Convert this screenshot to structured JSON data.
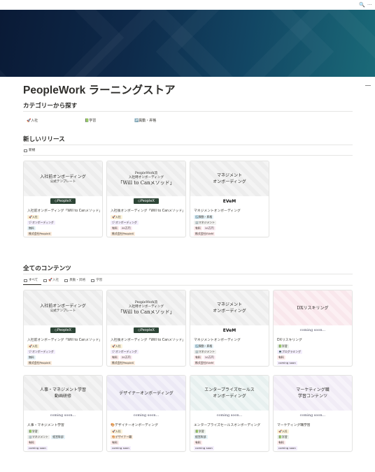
{
  "topbar": {
    "search_icon": "🔍",
    "more_icon": "···"
  },
  "page": {
    "title": "PeopleWork ラーニングストア"
  },
  "categories": {
    "heading": "カテゴリーから探す",
    "items": [
      {
        "label": "🚀入社"
      },
      {
        "label": "📗学習"
      },
      {
        "label": "↗️異動・昇格"
      }
    ]
  },
  "new_releases": {
    "heading": "新しいリリース",
    "view_label": "新規",
    "cards": [
      {
        "thumb_lines": [
          "入社前オンボーディング",
          "公式テンプレート"
        ],
        "logo": "◇PeopleX",
        "title": "入社前オンボーディング「Will to Canメソッド」",
        "rows": [
          [
            {
              "text": "🚀入社",
              "color": "yellow"
            }
          ],
          [
            {
              "text": "🏳オンボーディング",
              "color": "purple"
            }
          ],
          [
            {
              "text": "無料",
              "color": "blue"
            }
          ],
          [
            {
              "text": "株式会社PeopleX",
              "color": "orange"
            }
          ]
        ]
      },
      {
        "thumb_lines": [
          "PeopleWork流",
          "入社時オンボーディング",
          "「Will to Canメソッド」"
        ],
        "logo": "◇PeopleX",
        "title": "入社後オンボーディング「Will to Canメソッド」",
        "rows": [
          [
            {
              "text": "🚀入社",
              "color": "yellow"
            }
          ],
          [
            {
              "text": "🏳オンボーディング",
              "color": "purple"
            }
          ],
          [
            {
              "text": "有料",
              "color": "red"
            },
            {
              "text": "20万円",
              "color": "pink"
            }
          ],
          [
            {
              "text": "株式会社PeopleX",
              "color": "orange"
            }
          ]
        ]
      },
      {
        "thumb_lines": [
          "マネジメント",
          "オンボーディング"
        ],
        "logo": "EVeM",
        "title": "マネジメントオンボーディング",
        "rows": [
          [
            {
              "text": "↗️異動・昇格",
              "color": "blue"
            }
          ],
          [
            {
              "text": "🏢マネジメント",
              "color": "gray"
            }
          ],
          [
            {
              "text": "有料",
              "color": "red"
            },
            {
              "text": "10万円",
              "color": "pink"
            }
          ],
          [
            {
              "text": "株式会社EVeM",
              "color": "red"
            }
          ]
        ]
      }
    ]
  },
  "all_contents": {
    "heading": "全てのコンテンツ",
    "tabs": [
      {
        "label": "すべて"
      },
      {
        "label": "🚀入社"
      },
      {
        "label": "異動・昇格"
      },
      {
        "label": "学習"
      }
    ],
    "cards": [
      {
        "thumb_lines": [
          "入社前オンボーディング",
          "公式テンプレート"
        ],
        "logo": "◇PeopleX",
        "title": "入社前オンボーディング「Will to Canメソッド」",
        "rows": [
          [
            {
              "text": "🚀入社",
              "color": "yellow"
            }
          ],
          [
            {
              "text": "🏳オンボーディング",
              "color": "purple"
            }
          ],
          [
            {
              "text": "無料",
              "color": "blue"
            }
          ],
          [
            {
              "text": "株式会社PeopleX",
              "color": "orange"
            }
          ]
        ]
      },
      {
        "thumb_lines": [
          "PeopleWork流",
          "入社時オンボーディング",
          "「Will to Canメソッド」"
        ],
        "logo": "◇PeopleX",
        "title": "入社後オンボーディング「Will to Canメソッド」",
        "rows": [
          [
            {
              "text": "🚀入社",
              "color": "yellow"
            }
          ],
          [
            {
              "text": "🏳オンボーディング",
              "color": "purple"
            }
          ],
          [
            {
              "text": "有料",
              "color": "red"
            },
            {
              "text": "20万円",
              "color": "pink"
            }
          ],
          [
            {
              "text": "株式会社PeopleX",
              "color": "orange"
            }
          ]
        ]
      },
      {
        "thumb_lines": [
          "マネジメント",
          "オンボーディング"
        ],
        "logo": "EVeM",
        "title": "マネジメントオンボーディング",
        "rows": [
          [
            {
              "text": "↗️異動・昇格",
              "color": "blue"
            }
          ],
          [
            {
              "text": "🏢マネジメント",
              "color": "gray"
            }
          ],
          [
            {
              "text": "有料",
              "color": "red"
            },
            {
              "text": "10万円",
              "color": "pink"
            }
          ],
          [
            {
              "text": "株式会社EVeM",
              "color": "red"
            }
          ]
        ]
      },
      {
        "thumb_lines": [
          "DXリスキリング"
        ],
        "soon": "coming soon...",
        "title": "DXリスキリング",
        "rows": [
          [
            {
              "text": "📗学習",
              "color": "green"
            }
          ],
          [
            {
              "text": "💻プログラミング",
              "color": "purple"
            }
          ],
          [
            {
              "text": "有料",
              "color": "red"
            }
          ],
          [
            {
              "text": "coming soon",
              "color": "purple"
            }
          ]
        ]
      },
      {
        "thumb_lines": [
          "人事・マネジメント学習",
          "動画研修"
        ],
        "soon": "coming soon...",
        "title": "人事・マネジメント学習",
        "rows": [
          [
            {
              "text": "📗学習",
              "color": "green"
            }
          ],
          [
            {
              "text": "🏢マネジメント",
              "color": "gray"
            },
            {
              "text": "経営幹部",
              "color": "blue"
            }
          ],
          [
            {
              "text": "有料",
              "color": "red"
            }
          ],
          [
            {
              "text": "coming soon",
              "color": "purple"
            }
          ]
        ]
      },
      {
        "thumb_lines": [
          "デザイナーオンボーディング"
        ],
        "soon": "coming soon...",
        "title": "🎨デザイナーオンボーディング",
        "rows": [
          [
            {
              "text": "🚀入社",
              "color": "yellow"
            }
          ],
          [
            {
              "text": "🎨デザイナー職",
              "color": "orange"
            }
          ],
          [
            {
              "text": "有料",
              "color": "red"
            }
          ],
          [
            {
              "text": "coming soon",
              "color": "purple"
            }
          ]
        ]
      },
      {
        "thumb_lines": [
          "エンタープライズセールス",
          "オンボーディング"
        ],
        "soon": "coming soon...",
        "title": "エンタープライズセールスオンボーディング",
        "rows": [
          [
            {
              "text": "📗学習",
              "color": "green"
            }
          ],
          [
            {
              "text": "経営幹部",
              "color": "blue"
            }
          ],
          [
            {
              "text": "有料",
              "color": "red"
            }
          ],
          [
            {
              "text": "coming soon",
              "color": "purple"
            }
          ]
        ]
      },
      {
        "thumb_lines": [
          "マーケティング職",
          "学習コンテンツ"
        ],
        "soon": "coming soon...",
        "title": "マーケティング職学習",
        "rows": [
          [
            {
              "text": "🚀入社",
              "color": "yellow"
            }
          ],
          [
            {
              "text": "📗学習",
              "color": "green"
            }
          ],
          [
            {
              "text": "有料",
              "color": "red"
            }
          ],
          [
            {
              "text": "coming soon",
              "color": "purple"
            }
          ]
        ]
      }
    ]
  }
}
